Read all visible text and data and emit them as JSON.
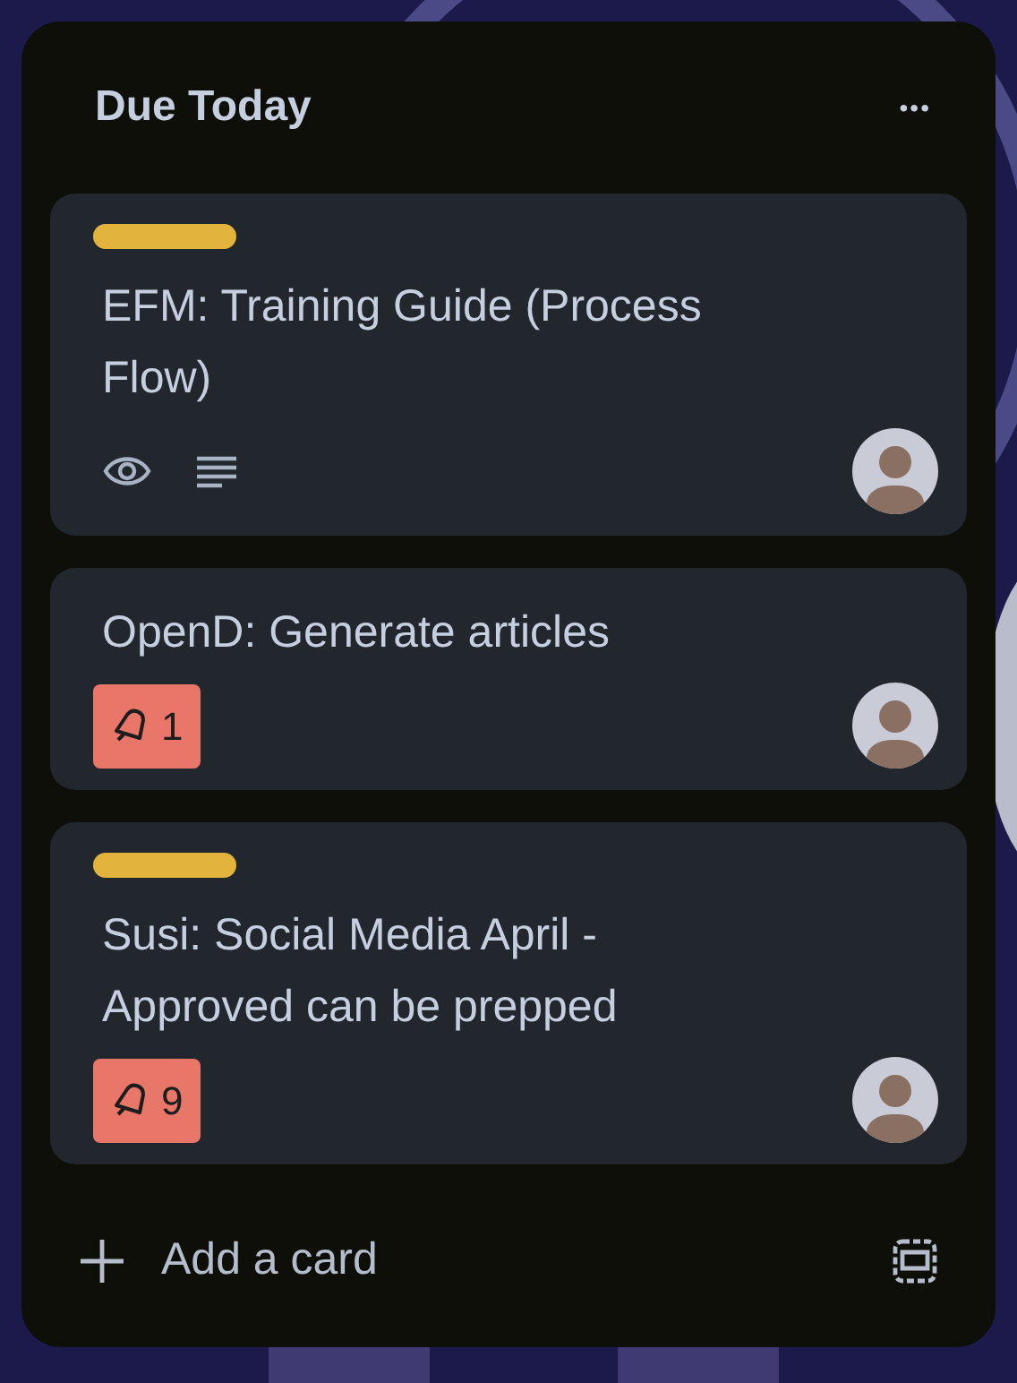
{
  "list": {
    "title": "Due Today",
    "menu": "•••"
  },
  "cards": [
    {
      "labels": [
        {
          "color": "#e2b43c"
        }
      ],
      "title": "EFM: Training Guide (Process Flow)",
      "watching": true,
      "has_description": true
    },
    {
      "title": "OpenD: Generate articles",
      "watching": false,
      "has_description": false,
      "due": {
        "text": "1",
        "overdue": true
      }
    },
    {
      "labels": [
        {
          "color": "#e2b43c"
        }
      ],
      "title": "Susi: Social Media April - Approved can be prepped",
      "watching": false,
      "has_description": false,
      "due": {
        "text": "9",
        "overdue": true
      }
    }
  ],
  "add_card": {
    "label": "Add a card"
  }
}
